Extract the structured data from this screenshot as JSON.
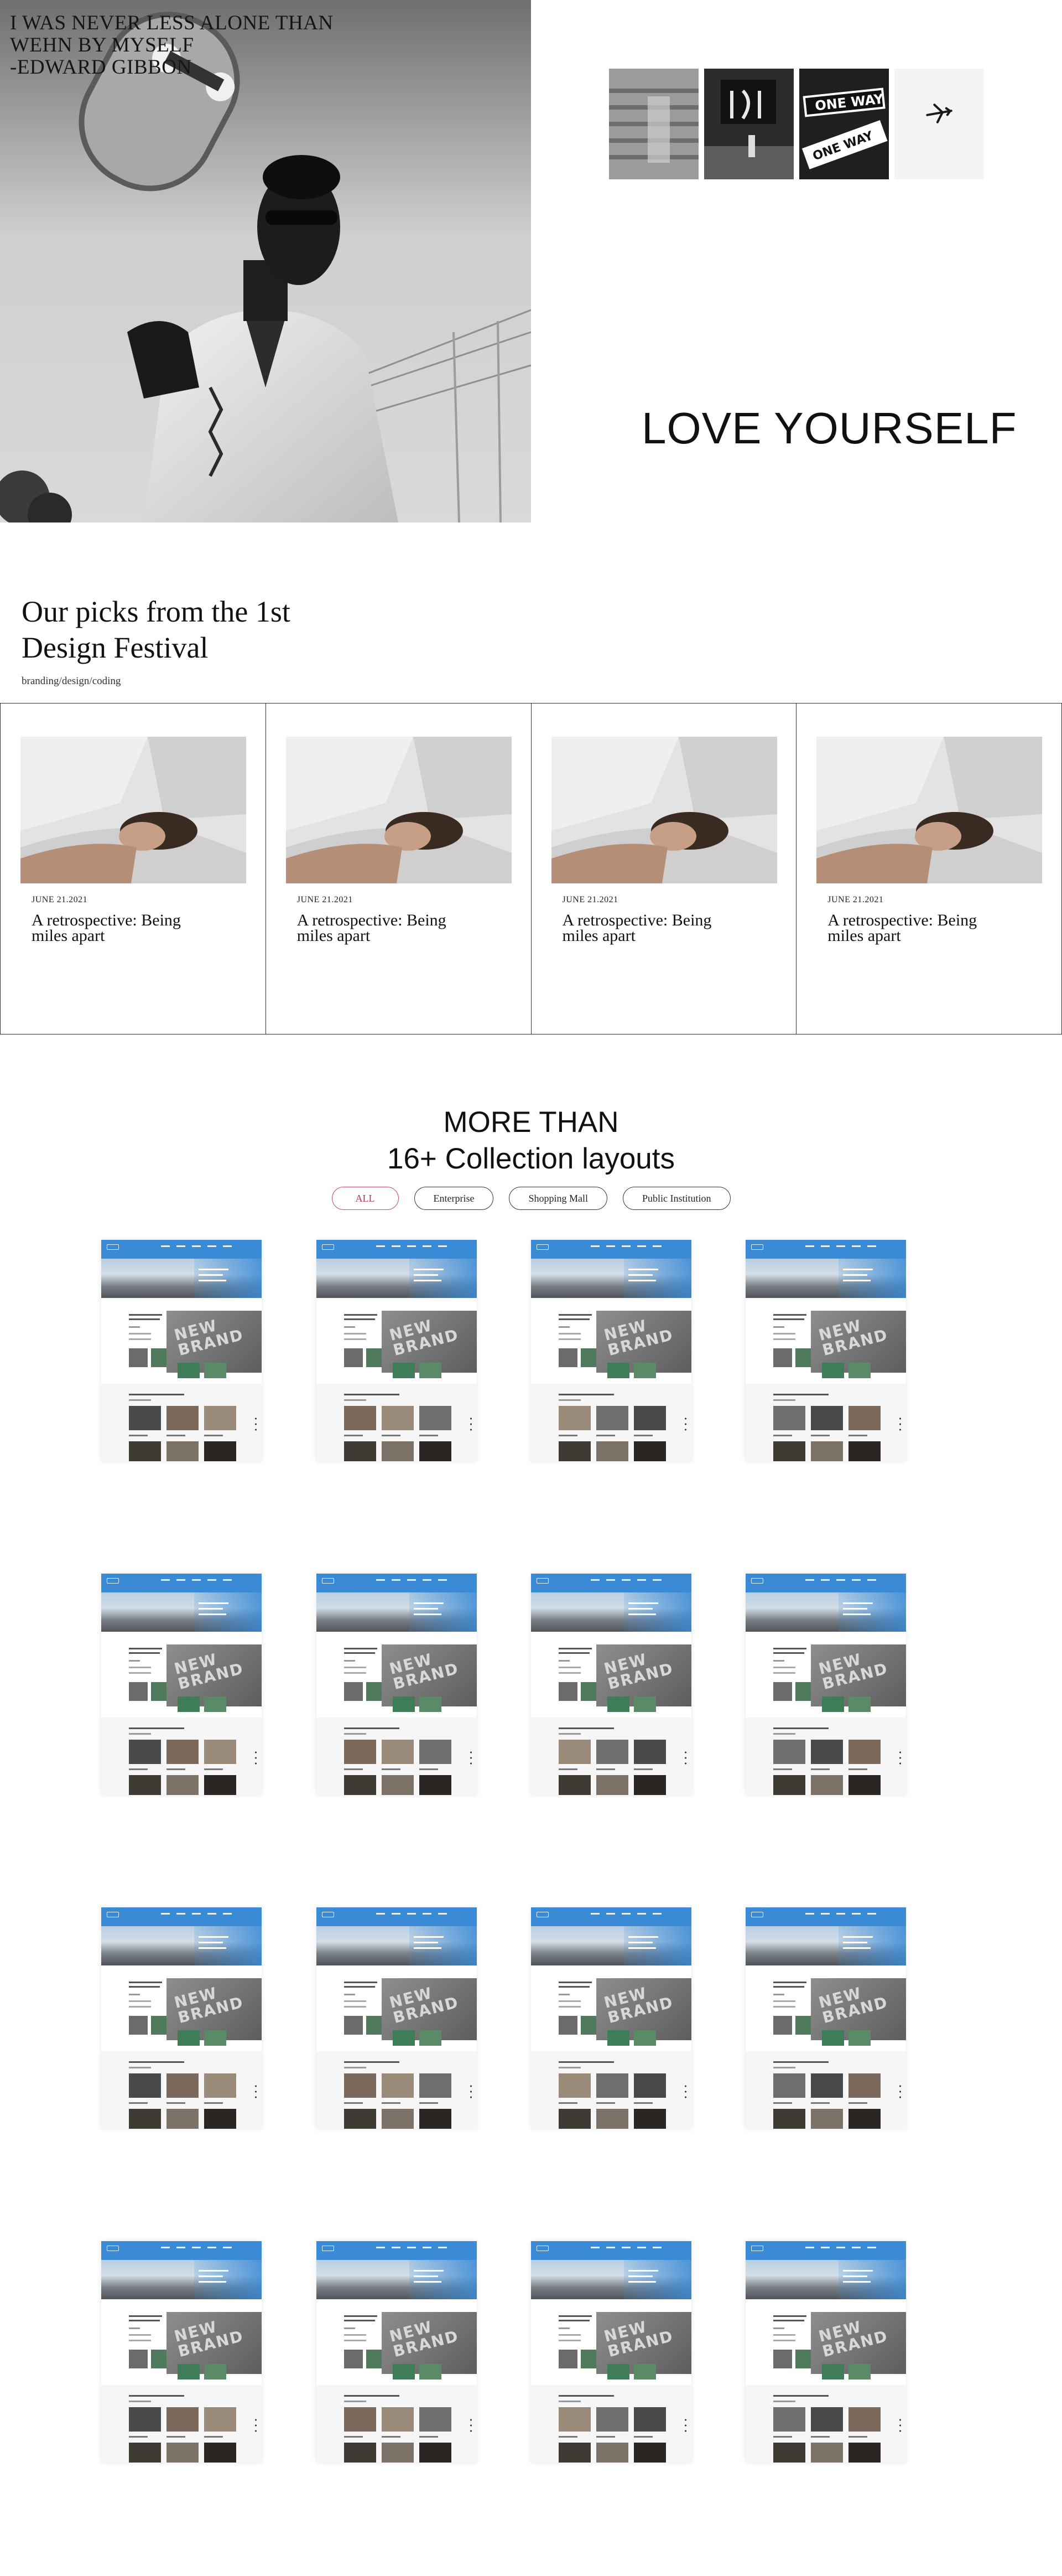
{
  "hero": {
    "quote": "I WAS NEVER LESS ALONE THAN\nWEHN BY MYSELF\n-EDWARD GIBBON",
    "tagline": "LOVE YOURSELF"
  },
  "picks": {
    "title_line1": "Our picks from the 1st",
    "title_line2": "Design Festival",
    "tags": "branding/design/coding",
    "cards": [
      {
        "date": "JUNE 21.2021",
        "title": "A retrospective: Being miles apart"
      },
      {
        "date": "JUNE 21.2021",
        "title": "A retrospective: Being miles apart"
      },
      {
        "date": "JUNE 21.2021",
        "title": "A retrospective: Being miles apart"
      },
      {
        "date": "JUNE 21.2021",
        "title": "A retrospective: Being miles apart"
      }
    ]
  },
  "collection": {
    "title_line1": "MORE THAN",
    "title_line2": "16+ Collection layouts",
    "filters": [
      "ALL",
      "Enterprise",
      "Shopping Mall",
      "Public Institution"
    ],
    "active_filter": "ALL",
    "layout_count": 16
  },
  "colors": {
    "accent": "#c0495d",
    "header_blue": "#3a8ad6",
    "text": "#111111"
  }
}
